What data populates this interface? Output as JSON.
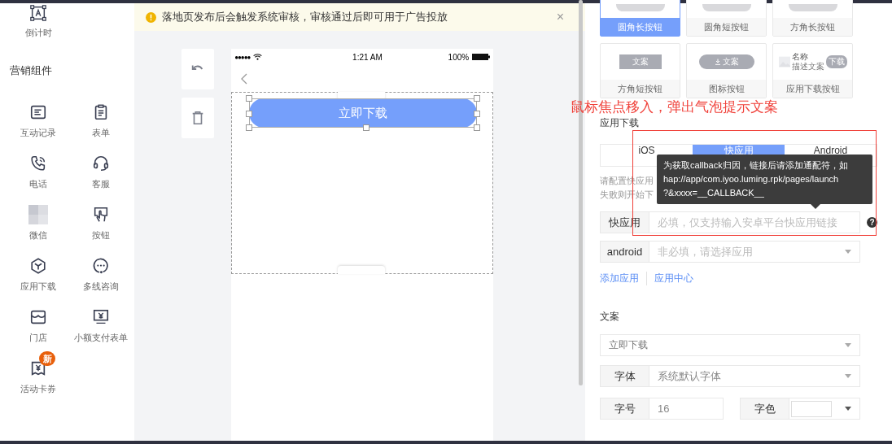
{
  "sidebar": {
    "top_item": {
      "label": "倒计时"
    },
    "section_title": "营销组件",
    "items": [
      {
        "label": "互动记录"
      },
      {
        "label": "表单"
      },
      {
        "label": "电话"
      },
      {
        "label": "客服"
      },
      {
        "label": "微信"
      },
      {
        "label": "按钮"
      },
      {
        "label": "应用下载"
      },
      {
        "label": "多线咨询"
      },
      {
        "label": "门店"
      },
      {
        "label": "小额支付表单"
      },
      {
        "label": "活动卡券",
        "badge": "新"
      }
    ]
  },
  "notice": {
    "text": "落地页发布后会触发系统审核，审核通过后即可用于广告投放",
    "close": "×"
  },
  "phone": {
    "signal": "●●●●●",
    "time": "1:21 AM",
    "battery": "100%",
    "button_label": "立即下载"
  },
  "annotation": "鼠标焦点移入，弹出气泡提示文案",
  "button_styles": [
    {
      "label": "圆角长按钮",
      "selected": true,
      "kind": "plain"
    },
    {
      "label": "圆角短按钮",
      "selected": false,
      "kind": "plain"
    },
    {
      "label": "方角长按钮",
      "selected": false,
      "kind": "plain"
    },
    {
      "label": "方角短按钮",
      "selected": false,
      "kind": "square",
      "preview": "文案"
    },
    {
      "label": "图标按钮",
      "selected": false,
      "kind": "icon",
      "preview": "文案"
    },
    {
      "label": "应用下载按钮",
      "selected": false,
      "kind": "app",
      "name": "名称",
      "desc": "描述文案",
      "preview": "下载"
    }
  ],
  "app_download": {
    "title": "应用下载",
    "tabs": [
      {
        "label": "iOS",
        "selected": false
      },
      {
        "label": "快应用",
        "selected": true
      },
      {
        "label": "Android",
        "selected": false
      }
    ],
    "hint_lines": [
      "请配置快应用",
      "失败则开始下"
    ],
    "tooltip": [
      "为获取callback归因，链接后请添加通配符，如",
      "hap://app/com.iyoo.luming.rpk/pages/launch",
      "?&xxxx=__CALLBACK__"
    ],
    "fields": [
      {
        "label": "快应用",
        "placeholder": "必填，仅支持输入安卓平台快应用链接",
        "kind": "input",
        "help": "?"
      },
      {
        "label": "android",
        "placeholder": "非必填，请选择应用",
        "kind": "select"
      }
    ],
    "links": [
      "添加应用",
      "应用中心"
    ]
  },
  "copy": {
    "title": "文案",
    "value": "立即下载",
    "font": {
      "label": "字体",
      "value": "系统默认字体"
    },
    "size": {
      "label": "字号",
      "value": "16"
    },
    "color": {
      "label": "字色"
    }
  }
}
